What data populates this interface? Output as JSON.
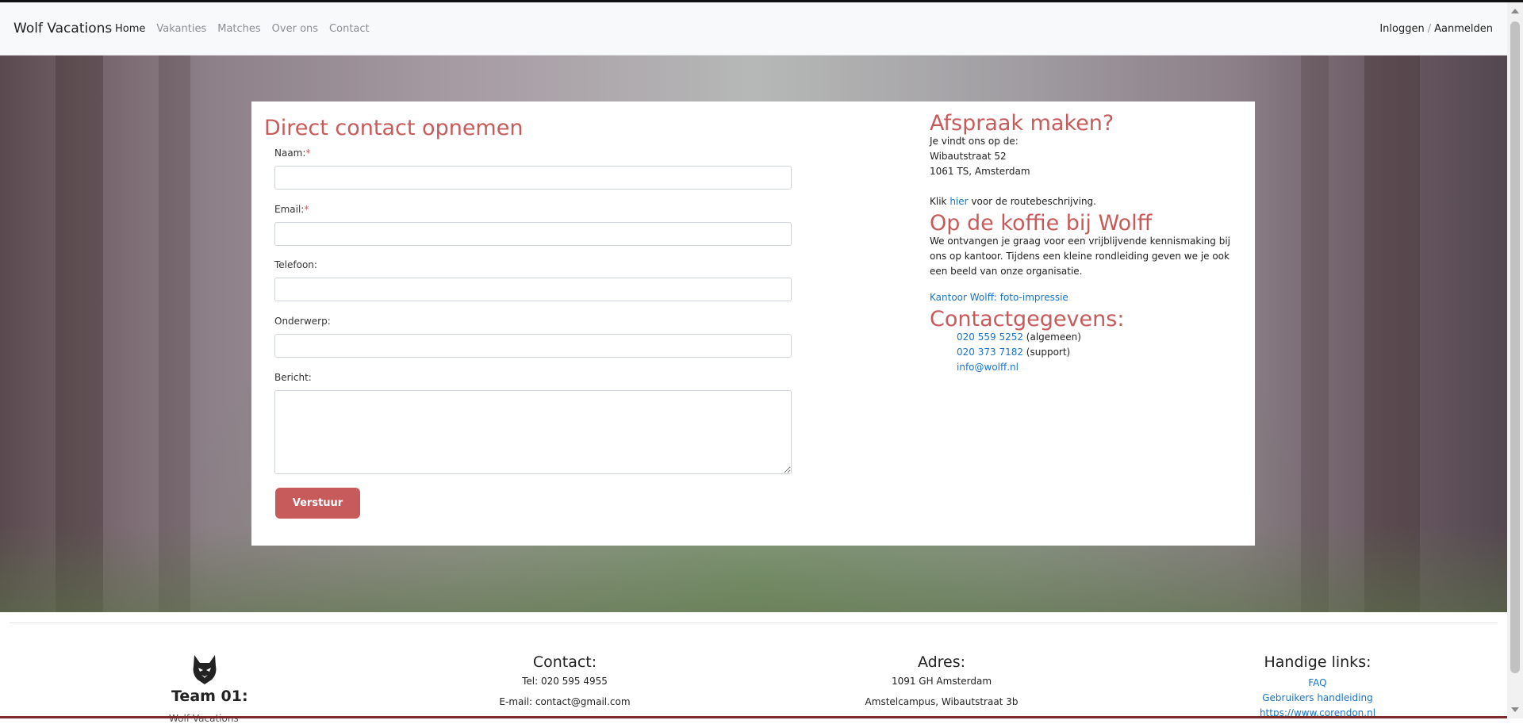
{
  "brand": "Wolf Vacations",
  "nav": {
    "items": [
      "Home",
      "Vakanties",
      "Matches",
      "Over ons",
      "Contact"
    ]
  },
  "auth": {
    "login": "Inloggen",
    "separator": "/",
    "register": "Aanmelden"
  },
  "form": {
    "title": "Direct contact opnemen",
    "name_label": "Naam:",
    "email_label": "Email:",
    "required_mark": "*",
    "phone_label": "Telefoon:",
    "subject_label": "Onderwerp:",
    "message_label": "Bericht:",
    "name_value": "",
    "email_value": "",
    "phone_value": "",
    "subject_value": "",
    "message_value": "",
    "submit": "Verstuur"
  },
  "appointment": {
    "title": "Afspraak maken?",
    "intro": "Je vindt ons op de:",
    "street": "Wibautstraat 52",
    "city": "1061 TS, Amsterdam",
    "route_prefix": "Klik ",
    "route_link": "hier",
    "route_suffix": " voor de routebeschrijving."
  },
  "coffee": {
    "title": "Op de koffie bij Wolff",
    "text": "We ontvangen je graag voor een vrijblijvende kennismaking bij ons op kantoor. Tijdens een kleine rondleiding geven we je ook een beeld van onze organisatie.",
    "photo_link": "Kantoor Wolff: foto-impressie"
  },
  "contact_details": {
    "title": "Contactgegevens:",
    "phone_general": "020 559 5252",
    "phone_general_note": " (algemeen)",
    "phone_support": "020 373 7182",
    "phone_support_note": " (support)",
    "email": "info@wolff.nl"
  },
  "footer": {
    "team_title": "Team 01:",
    "team_sub": "Wolf Vacations",
    "contact_title": "Contact:",
    "tel": "Tel: 020 595 4955",
    "email": "E-mail: contact@gmail.com",
    "address_title": "Adres:",
    "address_line1": "1091 GH Amsterdam",
    "address_line2": "Amstelcampus, Wibautstraat 3b",
    "links_title": "Handige links:",
    "link_faq": "FAQ",
    "link_manual": "Gebruikers handleiding",
    "link_corendon": "https://www.corendon.nl"
  },
  "colors": {
    "accent": "#c75b5b",
    "link": "#1a73c8"
  }
}
